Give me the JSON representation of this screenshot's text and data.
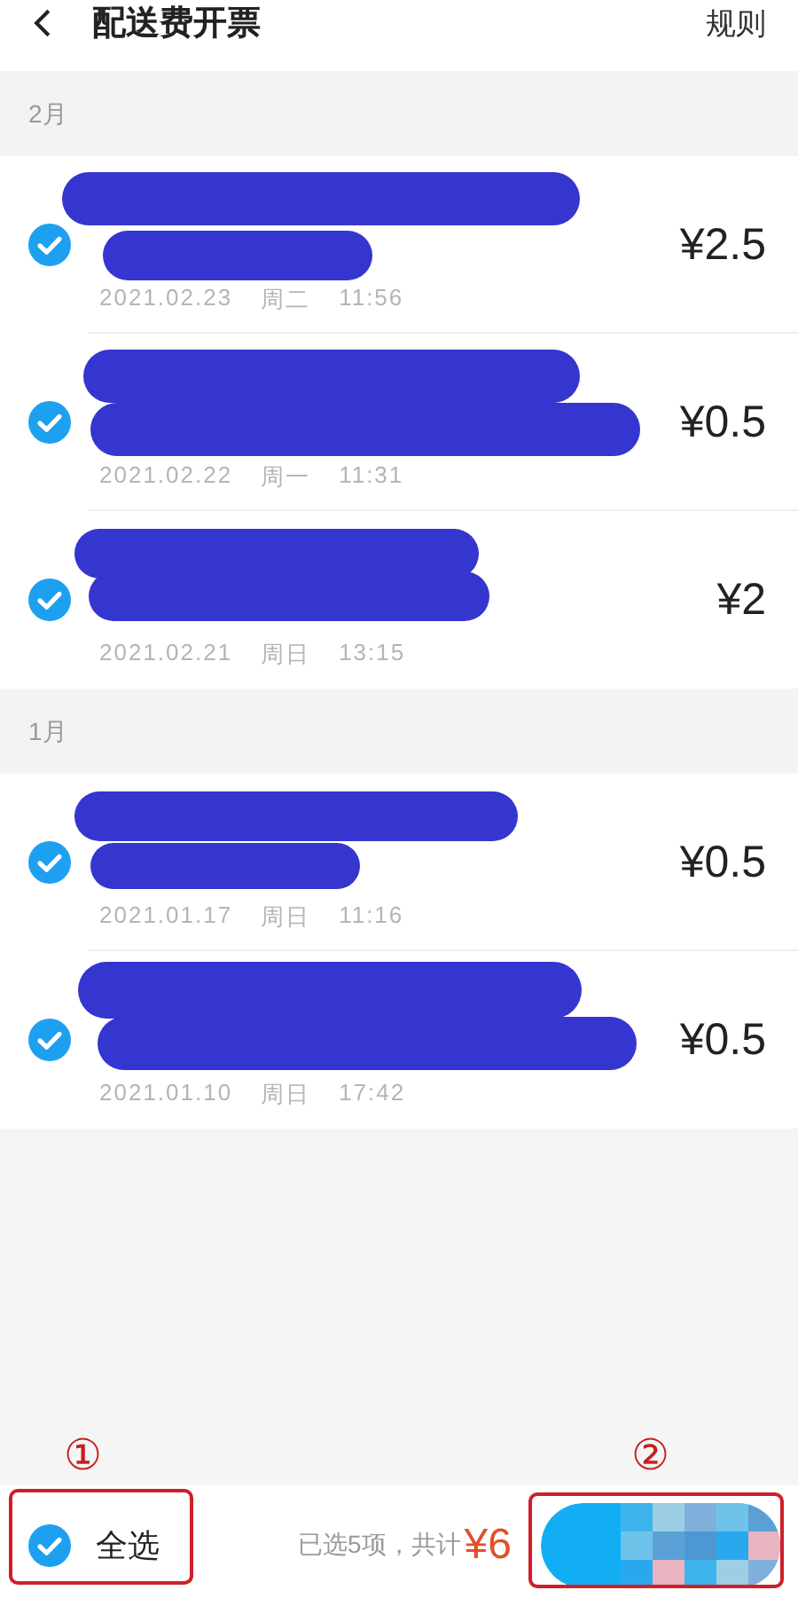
{
  "header": {
    "title": "配送费开票",
    "action": "规则"
  },
  "groups": [
    {
      "month": "2月",
      "orders": [
        {
          "date": "2021.02.23",
          "weekday": "周二",
          "time": "11:56",
          "amount": "¥2.5",
          "selected": true
        },
        {
          "date": "2021.02.22",
          "weekday": "周一",
          "time": "11:31",
          "amount": "¥0.5",
          "selected": true
        },
        {
          "date": "2021.02.21",
          "weekday": "周日",
          "time": "13:15",
          "amount": "¥2",
          "selected": true
        }
      ]
    },
    {
      "month": "1月",
      "orders": [
        {
          "date": "2021.01.17",
          "weekday": "周日",
          "time": "11:16",
          "amount": "¥0.5",
          "selected": true
        },
        {
          "date": "2021.01.10",
          "weekday": "周日",
          "time": "17:42",
          "amount": "¥0.5",
          "selected": true
        }
      ]
    }
  ],
  "footer": {
    "select_all": {
      "label": "全选",
      "checked": true
    },
    "summary": "已选5项，共计",
    "total": "¥6"
  },
  "annotations": [
    {
      "label": "①"
    },
    {
      "label": "②"
    }
  ]
}
